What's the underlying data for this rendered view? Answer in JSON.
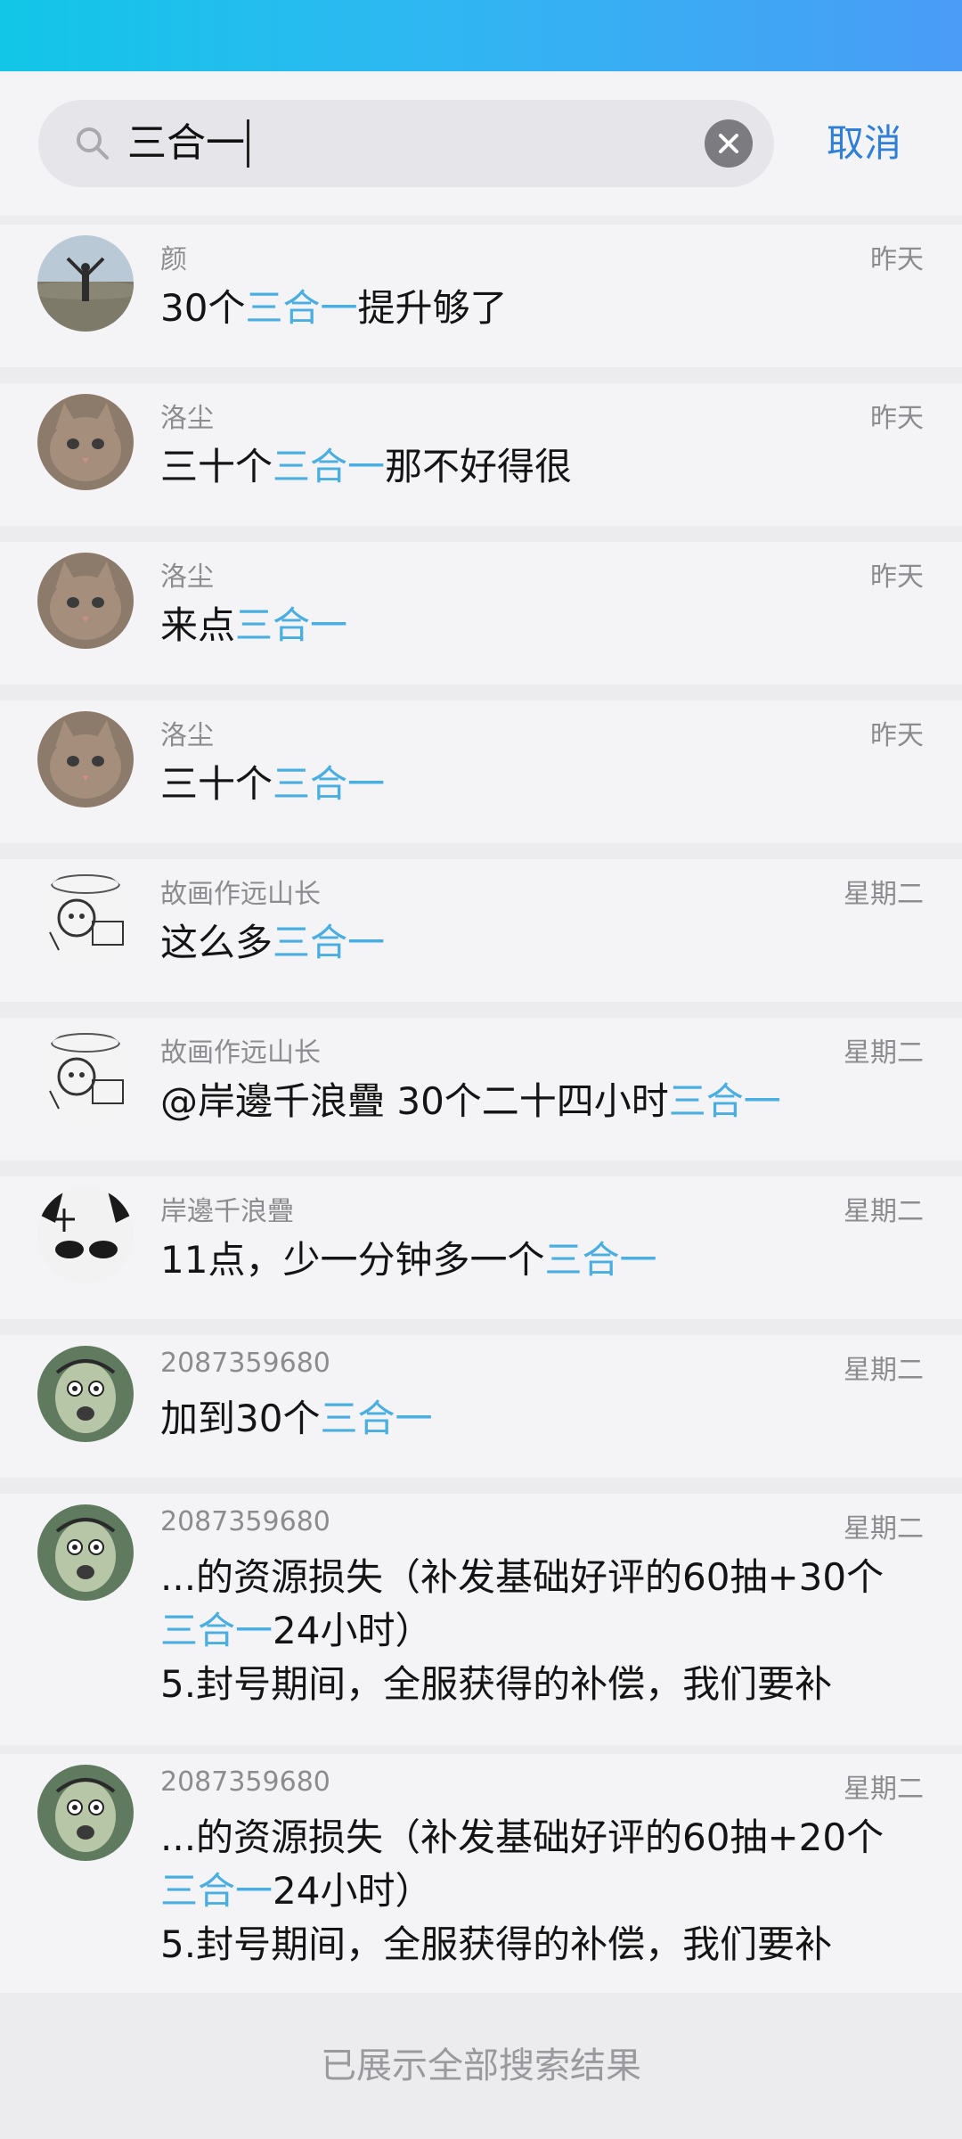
{
  "search": {
    "query": "三合一",
    "cancel_label": "取消"
  },
  "results": [
    {
      "sender": "颜",
      "time": "昨天",
      "avatar": "avatar-photo-person",
      "lines": [
        [
          {
            "t": "30个"
          },
          {
            "t": "三合一",
            "h": true
          },
          {
            "t": "提升够了"
          }
        ]
      ]
    },
    {
      "sender": "洛尘",
      "time": "昨天",
      "avatar": "avatar-kitten",
      "lines": [
        [
          {
            "t": "三十个"
          },
          {
            "t": "三合一",
            "h": true
          },
          {
            "t": "那不好得很"
          }
        ]
      ]
    },
    {
      "sender": "洛尘",
      "time": "昨天",
      "avatar": "avatar-kitten",
      "lines": [
        [
          {
            "t": "来点"
          },
          {
            "t": "三合一",
            "h": true
          }
        ]
      ]
    },
    {
      "sender": "洛尘",
      "time": "昨天",
      "avatar": "avatar-kitten",
      "lines": [
        [
          {
            "t": "三十个"
          },
          {
            "t": "三合一",
            "h": true
          }
        ]
      ]
    },
    {
      "sender": "故画作远山长",
      "time": "星期二",
      "avatar": "avatar-meme-sketch",
      "lines": [
        [
          {
            "t": "这么多"
          },
          {
            "t": "三合一",
            "h": true
          }
        ]
      ]
    },
    {
      "sender": "故画作远山长",
      "time": "星期二",
      "avatar": "avatar-meme-sketch",
      "lines": [
        [
          {
            "t": "@岸邊千浪疊 30个二十四小时"
          },
          {
            "t": "三合一",
            "h": true
          }
        ]
      ]
    },
    {
      "sender": "岸邊千浪疊",
      "time": "星期二",
      "avatar": "avatar-anime-eyes",
      "lines": [
        [
          {
            "t": "11点，少一分钟多一个"
          },
          {
            "t": "三合一",
            "h": true
          }
        ]
      ]
    },
    {
      "sender": "2087359680",
      "time": "星期二",
      "avatar": "avatar-cartoon-face",
      "lines": [
        [
          {
            "t": "加到30个"
          },
          {
            "t": "三合一",
            "h": true
          }
        ]
      ]
    },
    {
      "sender": "2087359680",
      "time": "星期二",
      "avatar": "avatar-cartoon-face",
      "lines": [
        [
          {
            "t": "...的资源损失（补发基础好评的60抽+30个"
          }
        ],
        [
          {
            "t": "三合一",
            "h": true
          },
          {
            "t": "24小时）"
          }
        ],
        [
          {
            "t": "5.封号期间，全服获得的补偿，我们要补"
          }
        ]
      ]
    },
    {
      "sender": "2087359680",
      "time": "星期二",
      "avatar": "avatar-cartoon-face",
      "lines": [
        [
          {
            "t": "...的资源损失（补发基础好评的60抽+20个"
          }
        ],
        [
          {
            "t": "三合一",
            "h": true
          },
          {
            "t": "24小时）"
          }
        ],
        [
          {
            "t": "5.封号期间，全服获得的补偿，我们要补"
          }
        ]
      ]
    }
  ],
  "footer": {
    "text": "已展示全部搜索结果"
  },
  "colors": {
    "highlight": "#4aaee0",
    "accent": "#2f7fd6"
  }
}
